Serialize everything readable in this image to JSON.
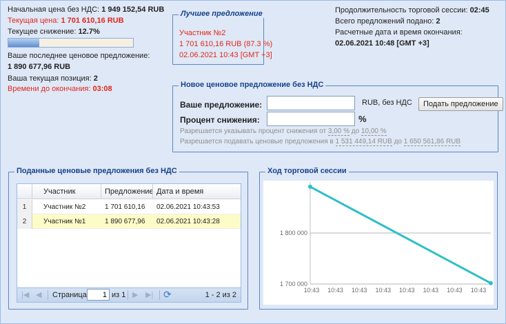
{
  "info": {
    "start_price_label": "Начальная цена без НДС:",
    "start_price_value": "1 949 152,54 RUB",
    "current_price_label": "Текущая цена:",
    "current_price_value": "1 701 610,16 RUB",
    "decrease_label": "Текущее снижение:",
    "decrease_value": "12.7%",
    "decrease_fraction": 0.127,
    "last_offer_label": "Ваше последнее ценовое предложение:",
    "last_offer_value": "1 890 677,96 RUB",
    "position_label": "Ваша текущая позиция:",
    "position_value": "2",
    "time_left_label": "Времени до окончания:",
    "time_left_value": "03:08"
  },
  "best_offer": {
    "title": "Лучшее предложение",
    "participant": "Участник №2",
    "amount": "1 701 610,16 RUB (87.3 %)",
    "datetime": "02.06.2021 10:43 [GMT +3]"
  },
  "session": {
    "duration_label": "Продолжительность торговой сессии:",
    "duration_value": "02:45",
    "total_label": "Всего предложений подано:",
    "total_value": "2",
    "end_label": "Расчетные дата и время окончания:",
    "end_value": "02.06.2021 10:48 [GMT +3]"
  },
  "new_offer": {
    "title": "Новое ценовое предложение без НДС",
    "offer_label": "Ваше предложение:",
    "offer_value": "",
    "offer_unit": "RUB, без НДС",
    "percent_label": "Процент снижения:",
    "percent_value": "",
    "percent_unit": "%",
    "submit_label": "Подать предложение",
    "hint1_prefix": "Разрешается указывать процент снижения от",
    "hint1_from": "3,00 %",
    "hint1_mid": "до",
    "hint1_to": "10,00 %",
    "hint2_prefix": "Разрешается подавать ценовые предложения в",
    "hint2_from": "1 531 449,14 RUB",
    "hint2_mid": "до",
    "hint2_to": "1 650 561,86 RUB"
  },
  "offers_panel": {
    "title": "Поданные ценовые предложения без НДС",
    "columns": [
      "Участник",
      "Предложение",
      "Дата и время"
    ],
    "rows": [
      {
        "num": "1",
        "participant": "Участник №2",
        "offer": "1 701 610,16",
        "datetime": "02.06.2021 10:43:53"
      },
      {
        "num": "2",
        "participant": "Участник №1",
        "offer": "1 890 677,96",
        "datetime": "02.06.2021 10:43:28"
      }
    ],
    "pager": {
      "page_label": "Страница",
      "page_value": "1",
      "of_label": "из 1",
      "range": "1 - 2 из 2"
    }
  },
  "chart_panel": {
    "title": "Ход торговой сессии"
  },
  "chart_data": {
    "type": "line",
    "title": "",
    "xlabel": "",
    "ylabel": "",
    "x_ticks": [
      "10:43",
      "10:43",
      "10:43",
      "10:43",
      "10:43",
      "10:43",
      "10:43",
      "10:43"
    ],
    "y_ticks": [
      "1 700 000",
      "1 800 000"
    ],
    "ylim": [
      1700000,
      1900000
    ],
    "series": [
      {
        "values": [
          1890677.96,
          1701610.16
        ],
        "color": "#2ebfc7"
      }
    ],
    "grid": true
  },
  "colors": {
    "accent": "#15428b",
    "red": "#e0271b",
    "series": "#2ebfc7"
  }
}
